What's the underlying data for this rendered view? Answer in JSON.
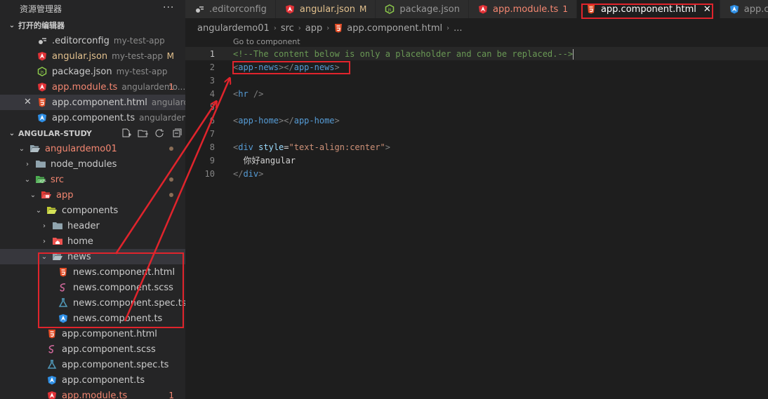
{
  "explorer": {
    "title": "资源管理器",
    "more": "···",
    "open_editors_header": "打开的编辑器",
    "open_editors": [
      {
        "icon": "settings-icon",
        "label": ".editorconfig",
        "desc": "my-test-app",
        "mark": "",
        "state": "normal"
      },
      {
        "icon": "angular-icon",
        "label": "angular.json",
        "desc": "my-test-app",
        "mark": "M",
        "state": "modified"
      },
      {
        "icon": "nodejs-icon",
        "label": "package.json",
        "desc": "my-test-app",
        "mark": "",
        "state": "normal"
      },
      {
        "icon": "angular-icon",
        "label": "app.module.ts",
        "desc": "angulardemo...",
        "mark": "1",
        "state": "error"
      },
      {
        "icon": "html-icon",
        "label": "app.component.html",
        "desc": "angularde...",
        "mark": "",
        "state": "active"
      },
      {
        "icon": "angular-ts-icon",
        "label": "app.component.ts",
        "desc": "angulardemo...",
        "mark": "",
        "state": "normal"
      }
    ],
    "workspace_header": "ANGULAR-STUDY",
    "tree": [
      {
        "label": "angulardemo01",
        "type": "folder-open",
        "depth": 0,
        "state": "error-dot"
      },
      {
        "label": "node_modules",
        "type": "folder",
        "depth": 1,
        "state": "normal"
      },
      {
        "label": "src",
        "type": "folder-open-src",
        "depth": 1,
        "state": "error-dot"
      },
      {
        "label": "app",
        "type": "folder-open-app",
        "depth": 2,
        "state": "error-dot"
      },
      {
        "label": "components",
        "type": "folder-open-comp",
        "depth": 3,
        "state": "normal"
      },
      {
        "label": "header",
        "type": "folder",
        "depth": 4,
        "state": "normal"
      },
      {
        "label": "home",
        "type": "folder-home",
        "depth": 4,
        "state": "normal"
      },
      {
        "label": "news",
        "type": "folder-open",
        "depth": 4,
        "state": "selected"
      },
      {
        "label": "news.component.html",
        "type": "html",
        "depth": 5,
        "state": "normal"
      },
      {
        "label": "news.component.scss",
        "type": "scss",
        "depth": 5,
        "state": "normal"
      },
      {
        "label": "news.component.spec.ts",
        "type": "spec",
        "depth": 5,
        "state": "normal"
      },
      {
        "label": "news.component.ts",
        "type": "ngts",
        "depth": 5,
        "state": "normal"
      },
      {
        "label": "app.component.html",
        "type": "html",
        "depth": 3,
        "state": "normal"
      },
      {
        "label": "app.component.scss",
        "type": "scss",
        "depth": 3,
        "state": "normal"
      },
      {
        "label": "app.component.spec.ts",
        "type": "spec",
        "depth": 3,
        "state": "normal"
      },
      {
        "label": "app.component.ts",
        "type": "ngts",
        "depth": 3,
        "state": "normal"
      },
      {
        "label": "app.module.ts",
        "type": "angular",
        "depth": 3,
        "state": "error",
        "mark": "1"
      }
    ]
  },
  "tabs": [
    {
      "label": ".editorconfig",
      "icon": "settings-icon",
      "badge": "",
      "state": "normal"
    },
    {
      "label": "angular.json",
      "icon": "angular-icon",
      "badge": "M",
      "state": "modified"
    },
    {
      "label": "package.json",
      "icon": "nodejs-icon",
      "badge": "",
      "state": "normal"
    },
    {
      "label": "app.module.ts",
      "icon": "angular-icon",
      "badge": "1",
      "state": "error"
    },
    {
      "label": "app.component.html",
      "icon": "html-icon",
      "badge": "",
      "state": "active"
    },
    {
      "label": "app.com",
      "icon": "angular-ts-icon",
      "badge": "",
      "state": "normal"
    }
  ],
  "breadcrumb": [
    "angulardemo01",
    "src",
    "app",
    "app.component.html",
    "..."
  ],
  "editor": {
    "codelens": "Go to component",
    "lines": [
      {
        "n": "1",
        "current": true,
        "tokens": [
          [
            "c-comment",
            "<!--The content below is only a placeholder and can be replaced.-->"
          ]
        ]
      },
      {
        "n": "2",
        "tokens": [
          [
            "c-punct",
            "<"
          ],
          [
            "c-tag",
            "app-news"
          ],
          [
            "c-punct",
            "></"
          ],
          [
            "c-tag",
            "app-news"
          ],
          [
            "c-punct",
            ">"
          ]
        ]
      },
      {
        "n": "3",
        "tokens": []
      },
      {
        "n": "4",
        "tokens": [
          [
            "c-punct",
            "<"
          ],
          [
            "c-tag",
            "hr"
          ],
          [
            "c-text",
            " "
          ],
          [
            "c-punct",
            "/>"
          ]
        ]
      },
      {
        "n": "5",
        "tokens": []
      },
      {
        "n": "6",
        "tokens": [
          [
            "c-punct",
            "<"
          ],
          [
            "c-tag",
            "app-home"
          ],
          [
            "c-punct",
            "></"
          ],
          [
            "c-tag",
            "app-home"
          ],
          [
            "c-punct",
            ">"
          ]
        ]
      },
      {
        "n": "7",
        "tokens": []
      },
      {
        "n": "8",
        "tokens": [
          [
            "c-punct",
            "<"
          ],
          [
            "c-tag",
            "div"
          ],
          [
            "c-text",
            " "
          ],
          [
            "c-attr",
            "style"
          ],
          [
            "c-text",
            "="
          ],
          [
            "c-str",
            "\"text-align:center\""
          ],
          [
            "c-punct",
            ">"
          ]
        ]
      },
      {
        "n": "9",
        "tokens": [
          [
            "c-text",
            "  你好angular"
          ]
        ]
      },
      {
        "n": "10",
        "tokens": [
          [
            "c-punct",
            "</"
          ],
          [
            "c-tag",
            "div"
          ],
          [
            "c-punct",
            ">"
          ]
        ]
      }
    ]
  },
  "colors": {
    "accent_red": "#e0242c",
    "modified": "#e2c08d",
    "error": "#f48771"
  }
}
